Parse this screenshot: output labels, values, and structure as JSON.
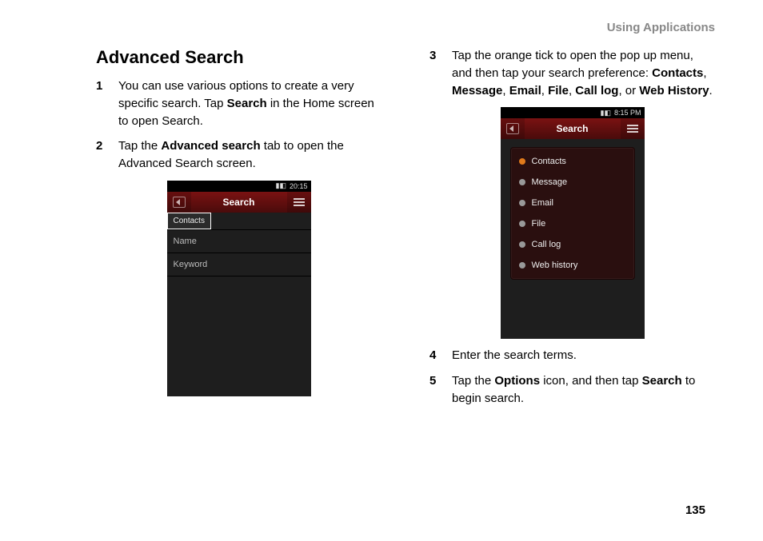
{
  "running_head": "Using Applications",
  "section_title": "Advanced Search",
  "page_number": "135",
  "left_steps": [
    {
      "num": "1",
      "pre": "You can use various options to create a very specific search. Tap ",
      "b1": "Search",
      "post": " in the Home screen to open Search."
    },
    {
      "num": "2",
      "pre": "Tap the ",
      "b1": "Advanced search",
      "post": " tab to open the Advanced Search screen."
    }
  ],
  "right_step3": {
    "num": "3",
    "pre": "Tap the orange tick to open the pop up menu, and then tap your search preference: ",
    "b1": "Contacts",
    "c1": ", ",
    "b2": "Message",
    "c2": ", ",
    "b3": "Email",
    "c3": ", ",
    "b4": "File",
    "c4": ", ",
    "b5": "Call log",
    "c5": ", or ",
    "b6": "Web History",
    "post": "."
  },
  "right_step4": {
    "num": "4",
    "text": "Enter the search terms."
  },
  "right_step5": {
    "num": "5",
    "pre": "Tap the ",
    "b1": "Options",
    "mid": " icon, and then tap ",
    "b2": "Search",
    "post": " to begin search."
  },
  "phone1": {
    "status_time": "20:15",
    "title": "Search",
    "tab": "Contacts",
    "field_name": "Name",
    "field_keyword": "Keyword"
  },
  "phone2": {
    "status_time": "8:15 PM",
    "title": "Search",
    "items": [
      "Contacts",
      "Message",
      "Email",
      "File",
      "Call log",
      "Web history"
    ]
  }
}
